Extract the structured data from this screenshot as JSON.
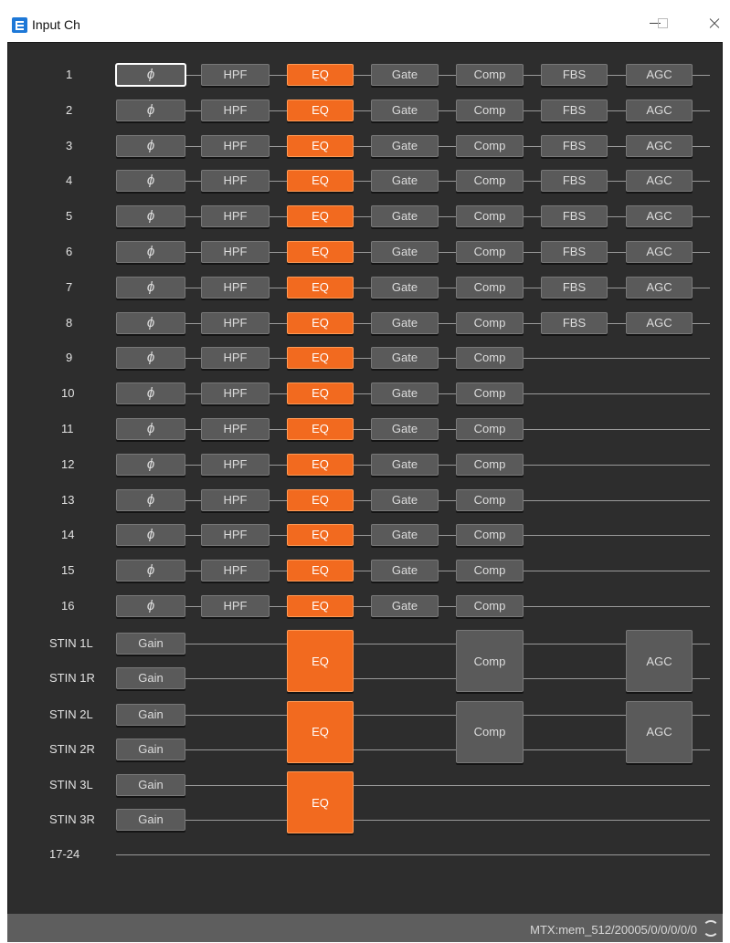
{
  "window": {
    "title": "Input Ch",
    "app_icon": "app-logo-icon",
    "controls": [
      "minimize-icon",
      "maximize-icon",
      "close-icon"
    ]
  },
  "colors": {
    "background": "#2d2d2d",
    "button": "#5a5a5a",
    "eq_active": "#f26a1f",
    "status_bar": "#5e5e5e"
  },
  "labels": {
    "phase": "ϕ",
    "hpf": "HPF",
    "eq": "EQ",
    "gate": "Gate",
    "comp": "Comp",
    "fbs": "FBS",
    "agc": "AGC",
    "gain": "Gain"
  },
  "channels": [
    {
      "label": "1",
      "fbs": true,
      "selected": true
    },
    {
      "label": "2",
      "fbs": true
    },
    {
      "label": "3",
      "fbs": true
    },
    {
      "label": "4",
      "fbs": true
    },
    {
      "label": "5",
      "fbs": true
    },
    {
      "label": "6",
      "fbs": true
    },
    {
      "label": "7",
      "fbs": true
    },
    {
      "label": "8",
      "fbs": true
    },
    {
      "label": "9",
      "fbs": false
    },
    {
      "label": "10",
      "fbs": false
    },
    {
      "label": "11",
      "fbs": false
    },
    {
      "label": "12",
      "fbs": false
    },
    {
      "label": "13",
      "fbs": false
    },
    {
      "label": "14",
      "fbs": false
    },
    {
      "label": "15",
      "fbs": false
    },
    {
      "label": "16",
      "fbs": false
    }
  ],
  "stereo_pairs": [
    {
      "left": "STIN 1L",
      "right": "STIN 1R",
      "comp": true,
      "agc": true
    },
    {
      "left": "STIN 2L",
      "right": "STIN 2R",
      "comp": true,
      "agc": true
    },
    {
      "left": "STIN 3L",
      "right": "STIN 3R",
      "comp": false,
      "agc": false
    }
  ],
  "extra_row": {
    "label": "17-24"
  },
  "status": {
    "text": "MTX:mem_512/20005/0/0/0/0/0",
    "icon": "sync-icon"
  }
}
